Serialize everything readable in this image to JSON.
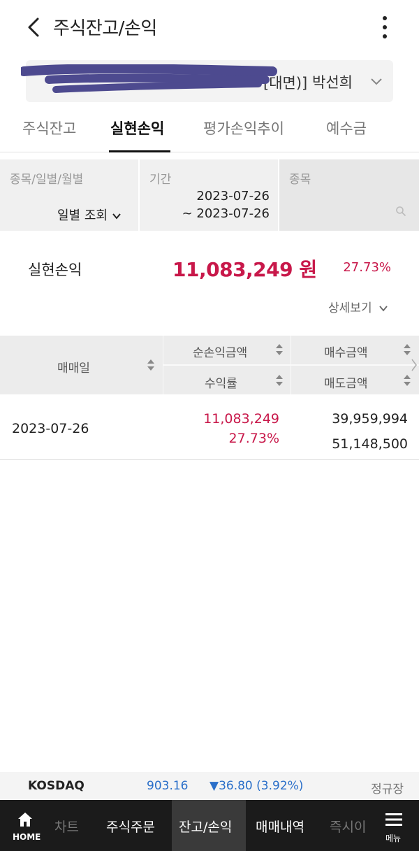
{
  "header": {
    "title": "주식잔고/손익",
    "back_icon": "chevron-left-icon",
    "more_icon": "more-vertical-icon"
  },
  "account": {
    "number_visible": "[대면)]",
    "holder": "박선희",
    "chevron_icon": "chevron-down-icon"
  },
  "tabs": [
    {
      "label": "주식잔고",
      "active": false
    },
    {
      "label": "실현손익",
      "active": true
    },
    {
      "label": "평가손익추이",
      "active": false
    },
    {
      "label": "예수금",
      "active": false
    }
  ],
  "filter": {
    "type_label": "종목/일별/월별",
    "type_value": "일별 조회",
    "period_label": "기간",
    "period_from": "2023-07-26",
    "period_to": "~ 2023-07-26",
    "stock_label": "종목",
    "stock_value": ""
  },
  "summary": {
    "label": "실현손익",
    "amount": "11,083,249 원",
    "rate": "27.73%",
    "detail_link": "상세보기"
  },
  "table": {
    "headers": {
      "date": "매매일",
      "net_profit": "순손익금액",
      "return_rate": "수익률",
      "buy_amount": "매수금액",
      "sell_amount": "매도금액"
    },
    "rows": [
      {
        "date": "2023-07-26",
        "net_profit": "11,083,249",
        "return_rate": "27.73%",
        "buy_amount": "39,959,994",
        "sell_amount": "51,148,500"
      }
    ]
  },
  "ticker": {
    "name": "KOSDAQ",
    "price": "903.16",
    "change": "▼36.80 (3.92%)",
    "session": "정규장"
  },
  "bottom_nav": {
    "home_label": "HOME",
    "items": [
      {
        "label": "차트",
        "faded": true
      },
      {
        "label": "주식주문",
        "faded": false
      },
      {
        "label": "잔고/손익",
        "faded": false,
        "active": true
      },
      {
        "label": "매매내역",
        "faded": false
      },
      {
        "label": "즉시이",
        "faded": true
      }
    ],
    "menu_label": "메뉴"
  },
  "colors": {
    "profit_red": "#c8184a",
    "index_blue": "#2a6fc9",
    "nav_dark": "#1b1b1b"
  }
}
